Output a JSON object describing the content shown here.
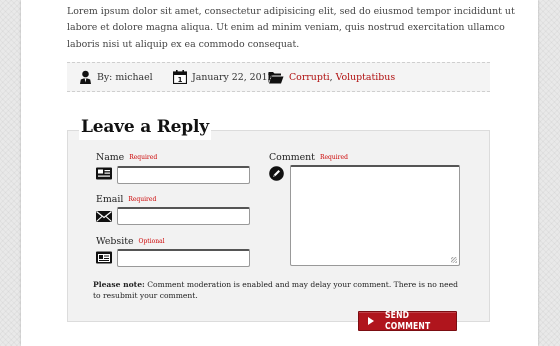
{
  "post": {
    "excerpt": "Lorem ipsum dolor sit amet, consectetur adipisicing elit, sed do eiusmod tempor incididunt ut labore et dolore magna aliqua. Ut enim ad minim veniam, quis nostrud exercitation ullamco laboris nisi ut aliquip ex ea commodo consequat."
  },
  "meta": {
    "author": "By: michael",
    "date": "January 22, 2012",
    "categories": [
      "Corrupti",
      "Voluptatibus"
    ],
    "separator": ","
  },
  "reply": {
    "title": "Leave a Reply",
    "name_label": "Name",
    "name_req": "Required",
    "email_label": "Email",
    "email_req": "Required",
    "website_label": "Website",
    "website_req": "Optional",
    "comment_label": "Comment",
    "comment_req": "Required",
    "note_bold": "Please note:",
    "note_text": " Comment moderation is enabled and may delay your comment. There is no need to resubmit your comment.",
    "submit_label": "SEND COMMENT"
  },
  "colors": {
    "accent_red": "#b0151d",
    "required_red": "#c00000"
  },
  "icons": {
    "author": "person-icon",
    "date": "calendar-icon",
    "category": "folder-icon",
    "name": "id-card-icon",
    "email": "envelope-icon",
    "website": "browser-card-icon",
    "comment": "pen-icon",
    "submit": "play-arrow-icon"
  }
}
